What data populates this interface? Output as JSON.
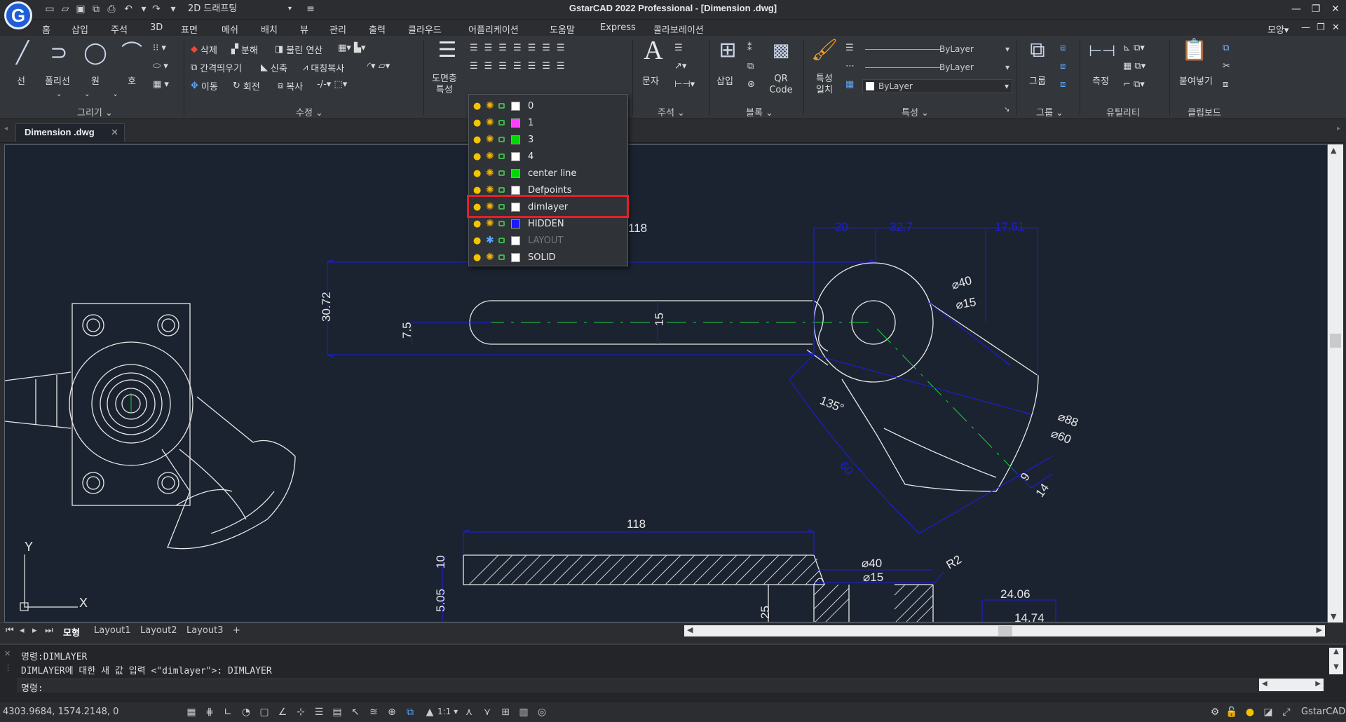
{
  "app": {
    "logo_letter": "G",
    "title": "GstarCAD 2022 Professional - [Dimension .dwg]",
    "workspace": "2D 드래프팅",
    "brand_color": "#1e5fd8"
  },
  "menu": [
    "홈",
    "삽입",
    "주석",
    "3D",
    "표면",
    "메쉬",
    "배치",
    "뷰",
    "관리",
    "출력",
    "클라우드",
    "어플리케이션",
    "도움말",
    "Express",
    "콜라보레이션"
  ],
  "menu_right": "모양",
  "ribbon": {
    "draw": {
      "line": "선",
      "polyline": "폴리선",
      "circle": "원",
      "arc": "호",
      "panel": "그리기"
    },
    "modify": {
      "erase": "삭제",
      "explode": "분해",
      "boolean": "불린 연산",
      "offset": "간격띄우기",
      "stretch": "신축",
      "mirror": "대칭복사",
      "move": "이동",
      "rotate": "회전",
      "copy": "복사",
      "panel": "수정"
    },
    "layer": {
      "properties_1": "도면층",
      "properties_2": "특성",
      "current_layer": "0"
    },
    "annotation": {
      "text": "문자",
      "panel": "주석"
    },
    "block": {
      "insert": "삽입",
      "qr_1": "QR",
      "qr_2": "Code",
      "panel": "블록"
    },
    "properties": {
      "match_1": "특성",
      "match_2": "일치",
      "color": "ByLayer",
      "linetype": "ByLayer",
      "lineweight": "ByLayer",
      "panel": "특성"
    },
    "group": {
      "group": "그룹",
      "panel": "그룹"
    },
    "utility": {
      "measure": "측정",
      "panel": "유틸리티"
    },
    "clipboard": {
      "paste": "붙여넣기",
      "panel": "클립보드"
    }
  },
  "document_tab": "Dimension .dwg",
  "layers": [
    {
      "name": "0",
      "color": "#ffffff",
      "frozen": false
    },
    {
      "name": "1",
      "color": "#ff40ff",
      "frozen": false
    },
    {
      "name": "3",
      "color": "#00d800",
      "frozen": false
    },
    {
      "name": "4",
      "color": "#ffffff",
      "frozen": false
    },
    {
      "name": "center line",
      "color": "#00d800",
      "frozen": false
    },
    {
      "name": "Defpoints",
      "color": "#ffffff",
      "frozen": false
    },
    {
      "name": "dimlayer",
      "color": "#ffffff",
      "frozen": false
    },
    {
      "name": "HIDDEN",
      "color": "#1a1aff",
      "frozen": false
    },
    {
      "name": "LAYOUT",
      "color": "#ffffff",
      "frozen": true
    },
    {
      "name": "SOLID",
      "color": "#ffffff",
      "frozen": false
    }
  ],
  "highlighted_layer": "dimlayer",
  "dimensions": {
    "d118_top": "118",
    "d20": "20",
    "d32_7": "32.7",
    "d17_51": "17.51",
    "d30_72": "30.72",
    "d7_5": "7.5",
    "d15": "15",
    "phi40": "⌀40",
    "phi15": "⌀15",
    "phi88": "⌀88",
    "phi60": "⌀60",
    "ang135": "135°",
    "d60": "60",
    "d9": "9",
    "d14": "14",
    "d118_bot": "118",
    "d10": "10",
    "d5_05": "5.05",
    "d25": "25",
    "phi40_b": "⌀40",
    "phi15_b": "⌀15",
    "r2": "R2",
    "d24_06": "24.06",
    "d14_74": "14.74"
  },
  "axis": {
    "x": "X",
    "y": "Y"
  },
  "layout_tabs": [
    "모형",
    "Layout1",
    "Layout2",
    "Layout3",
    "+"
  ],
  "command": {
    "line1": "명령:DIMLAYER",
    "line2": "DIMLAYER에 대한 새 값 입력 <\"dimlayer\">: DIMLAYER",
    "prompt": "명령:"
  },
  "status": {
    "coords": "4303.9684, 1574.2148, 0",
    "scale": "1:1",
    "brand": "GstarCAD"
  },
  "colors": {
    "dimension": "#1d1ddc",
    "geometry": "#e8e8e8",
    "centerline": "#1fcf3a",
    "highlight": "#e32028"
  }
}
